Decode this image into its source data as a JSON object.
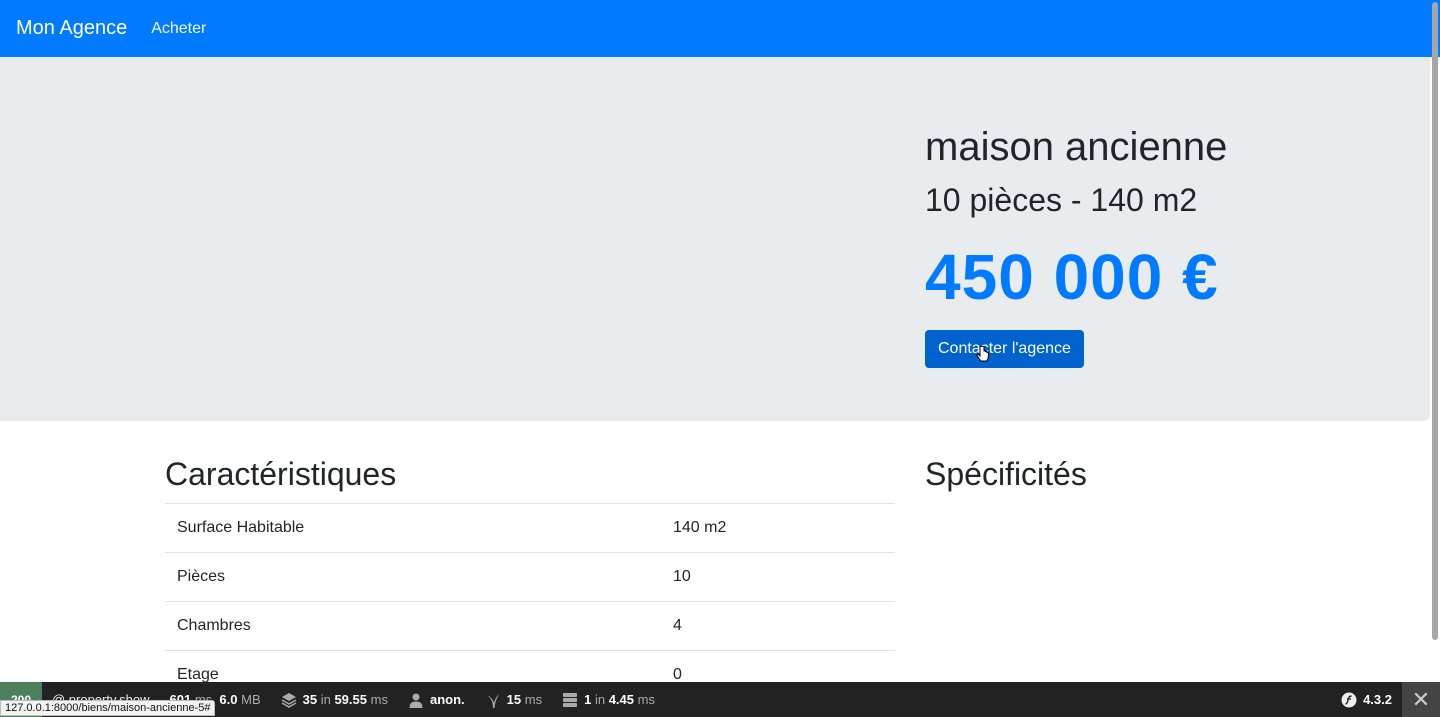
{
  "navbar": {
    "brand": "Mon Agence",
    "link": "Acheter"
  },
  "hero": {
    "title": "maison ancienne",
    "subtitle": "10 pièces - 140 m2",
    "price": "450 000 €",
    "contact_button": "Contacter l'agence"
  },
  "characteristics": {
    "heading": "Caractéristiques",
    "rows": [
      {
        "label": "Surface Habitable",
        "value": "140 m2"
      },
      {
        "label": "Pièces",
        "value": "10"
      },
      {
        "label": "Chambres",
        "value": "4"
      },
      {
        "label": "Etage",
        "value": "0"
      }
    ]
  },
  "specifics": {
    "heading": "Spécificités"
  },
  "toolbar": {
    "status_code": "200",
    "route": "@ property.show",
    "time": "601",
    "time_unit": "ms",
    "memory": "6.0",
    "memory_unit": "MB",
    "queries_count": "35",
    "queries_in": "in",
    "queries_time": "59.55",
    "queries_unit": "ms",
    "user": "anon.",
    "render_time": "15",
    "render_unit": "ms",
    "cache_count": "1",
    "cache_in": "in",
    "cache_time": "4.45",
    "cache_unit": "ms",
    "version": "4.3.2"
  },
  "status_url": "127.0.0.1:8000/biens/maison-ancienne-5#",
  "colors": {
    "primary": "#007bff",
    "hero_bg": "#e9ecef",
    "toolbar_bg": "#222222",
    "status_ok": "#4f805d"
  }
}
